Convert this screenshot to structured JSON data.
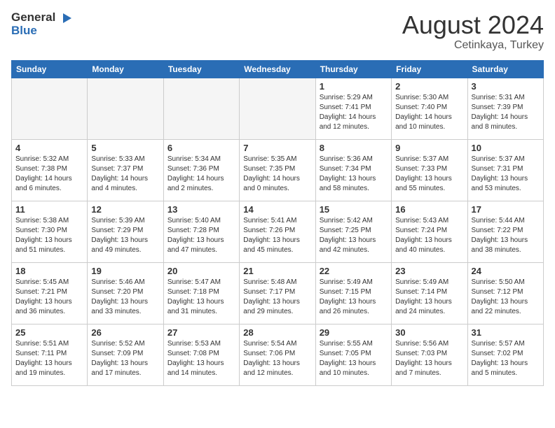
{
  "logo": {
    "general": "General",
    "blue": "Blue"
  },
  "title": {
    "month_year": "August 2024",
    "location": "Cetinkaya, Turkey"
  },
  "weekdays": [
    "Sunday",
    "Monday",
    "Tuesday",
    "Wednesday",
    "Thursday",
    "Friday",
    "Saturday"
  ],
  "weeks": [
    [
      {
        "day": "",
        "empty": true
      },
      {
        "day": "",
        "empty": true
      },
      {
        "day": "",
        "empty": true
      },
      {
        "day": "",
        "empty": true
      },
      {
        "day": "1",
        "sunrise": "5:29 AM",
        "sunset": "7:41 PM",
        "daylight": "14 hours and 12 minutes."
      },
      {
        "day": "2",
        "sunrise": "5:30 AM",
        "sunset": "7:40 PM",
        "daylight": "14 hours and 10 minutes."
      },
      {
        "day": "3",
        "sunrise": "5:31 AM",
        "sunset": "7:39 PM",
        "daylight": "14 hours and 8 minutes."
      }
    ],
    [
      {
        "day": "4",
        "sunrise": "5:32 AM",
        "sunset": "7:38 PM",
        "daylight": "14 hours and 6 minutes."
      },
      {
        "day": "5",
        "sunrise": "5:33 AM",
        "sunset": "7:37 PM",
        "daylight": "14 hours and 4 minutes."
      },
      {
        "day": "6",
        "sunrise": "5:34 AM",
        "sunset": "7:36 PM",
        "daylight": "14 hours and 2 minutes."
      },
      {
        "day": "7",
        "sunrise": "5:35 AM",
        "sunset": "7:35 PM",
        "daylight": "14 hours and 0 minutes."
      },
      {
        "day": "8",
        "sunrise": "5:36 AM",
        "sunset": "7:34 PM",
        "daylight": "13 hours and 58 minutes."
      },
      {
        "day": "9",
        "sunrise": "5:37 AM",
        "sunset": "7:33 PM",
        "daylight": "13 hours and 55 minutes."
      },
      {
        "day": "10",
        "sunrise": "5:37 AM",
        "sunset": "7:31 PM",
        "daylight": "13 hours and 53 minutes."
      }
    ],
    [
      {
        "day": "11",
        "sunrise": "5:38 AM",
        "sunset": "7:30 PM",
        "daylight": "13 hours and 51 minutes."
      },
      {
        "day": "12",
        "sunrise": "5:39 AM",
        "sunset": "7:29 PM",
        "daylight": "13 hours and 49 minutes."
      },
      {
        "day": "13",
        "sunrise": "5:40 AM",
        "sunset": "7:28 PM",
        "daylight": "13 hours and 47 minutes."
      },
      {
        "day": "14",
        "sunrise": "5:41 AM",
        "sunset": "7:26 PM",
        "daylight": "13 hours and 45 minutes."
      },
      {
        "day": "15",
        "sunrise": "5:42 AM",
        "sunset": "7:25 PM",
        "daylight": "13 hours and 42 minutes."
      },
      {
        "day": "16",
        "sunrise": "5:43 AM",
        "sunset": "7:24 PM",
        "daylight": "13 hours and 40 minutes."
      },
      {
        "day": "17",
        "sunrise": "5:44 AM",
        "sunset": "7:22 PM",
        "daylight": "13 hours and 38 minutes."
      }
    ],
    [
      {
        "day": "18",
        "sunrise": "5:45 AM",
        "sunset": "7:21 PM",
        "daylight": "13 hours and 36 minutes."
      },
      {
        "day": "19",
        "sunrise": "5:46 AM",
        "sunset": "7:20 PM",
        "daylight": "13 hours and 33 minutes."
      },
      {
        "day": "20",
        "sunrise": "5:47 AM",
        "sunset": "7:18 PM",
        "daylight": "13 hours and 31 minutes."
      },
      {
        "day": "21",
        "sunrise": "5:48 AM",
        "sunset": "7:17 PM",
        "daylight": "13 hours and 29 minutes."
      },
      {
        "day": "22",
        "sunrise": "5:49 AM",
        "sunset": "7:15 PM",
        "daylight": "13 hours and 26 minutes."
      },
      {
        "day": "23",
        "sunrise": "5:49 AM",
        "sunset": "7:14 PM",
        "daylight": "13 hours and 24 minutes."
      },
      {
        "day": "24",
        "sunrise": "5:50 AM",
        "sunset": "7:12 PM",
        "daylight": "13 hours and 22 minutes."
      }
    ],
    [
      {
        "day": "25",
        "sunrise": "5:51 AM",
        "sunset": "7:11 PM",
        "daylight": "13 hours and 19 minutes."
      },
      {
        "day": "26",
        "sunrise": "5:52 AM",
        "sunset": "7:09 PM",
        "daylight": "13 hours and 17 minutes."
      },
      {
        "day": "27",
        "sunrise": "5:53 AM",
        "sunset": "7:08 PM",
        "daylight": "13 hours and 14 minutes."
      },
      {
        "day": "28",
        "sunrise": "5:54 AM",
        "sunset": "7:06 PM",
        "daylight": "13 hours and 12 minutes."
      },
      {
        "day": "29",
        "sunrise": "5:55 AM",
        "sunset": "7:05 PM",
        "daylight": "13 hours and 10 minutes."
      },
      {
        "day": "30",
        "sunrise": "5:56 AM",
        "sunset": "7:03 PM",
        "daylight": "13 hours and 7 minutes."
      },
      {
        "day": "31",
        "sunrise": "5:57 AM",
        "sunset": "7:02 PM",
        "daylight": "13 hours and 5 minutes."
      }
    ]
  ]
}
